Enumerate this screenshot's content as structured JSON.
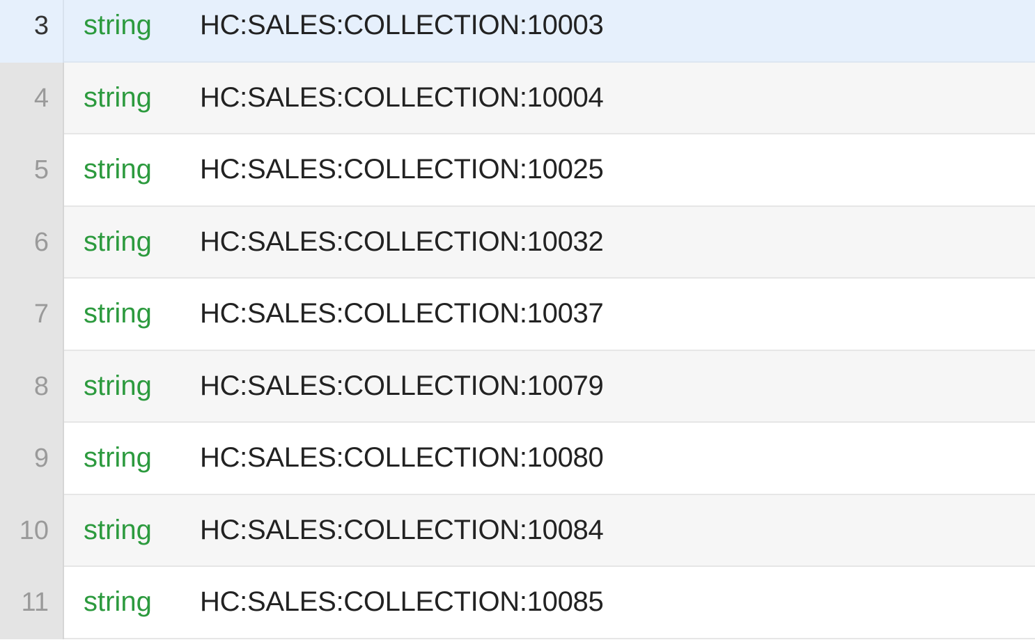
{
  "rows": [
    {
      "num": "3",
      "type": "string",
      "value": "HC:SALES:COLLECTION:10003",
      "selected": true
    },
    {
      "num": "4",
      "type": "string",
      "value": "HC:SALES:COLLECTION:10004"
    },
    {
      "num": "5",
      "type": "string",
      "value": "HC:SALES:COLLECTION:10025"
    },
    {
      "num": "6",
      "type": "string",
      "value": "HC:SALES:COLLECTION:10032"
    },
    {
      "num": "7",
      "type": "string",
      "value": "HC:SALES:COLLECTION:10037"
    },
    {
      "num": "8",
      "type": "string",
      "value": "HC:SALES:COLLECTION:10079"
    },
    {
      "num": "9",
      "type": "string",
      "value": "HC:SALES:COLLECTION:10080"
    },
    {
      "num": "10",
      "type": "string",
      "value": "HC:SALES:COLLECTION:10084"
    },
    {
      "num": "11",
      "type": "string",
      "value": "HC:SALES:COLLECTION:10085"
    }
  ],
  "colors": {
    "type_text": "#2c9a3e",
    "selected_row": "#e6f0fc",
    "gutter": "#e4e4e4"
  }
}
